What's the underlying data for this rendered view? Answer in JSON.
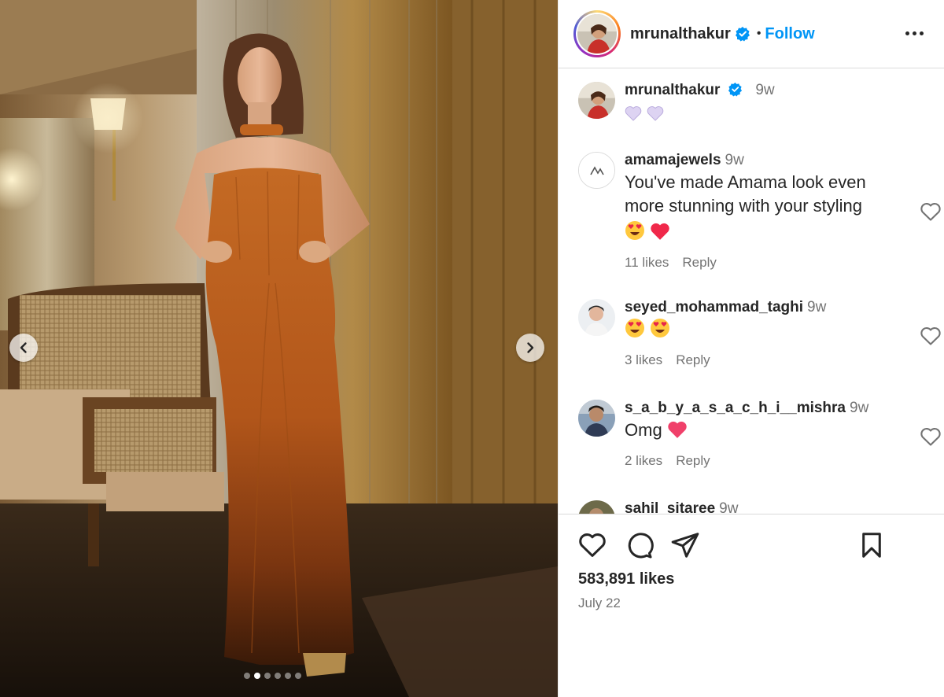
{
  "post": {
    "username": "mrunalthakur",
    "follow_label": "Follow",
    "separator": "•",
    "likes": "583,891 likes",
    "date": "July 22",
    "carousel_slides": 6,
    "carousel_active_index": 1
  },
  "caption": {
    "username": "mrunalthakur",
    "time": "9w",
    "text_emoji": "purple-heart-emoji x2"
  },
  "comments": [
    {
      "username": "amamajewels",
      "time": "9w",
      "text": "You've made Amama look even more stunning with your styling",
      "emoji": "heart-eyes-emoji, red-heart-emoji",
      "likes": "11 likes",
      "reply": "Reply"
    },
    {
      "username": "seyed_mohammad_taghi",
      "time": "9w",
      "text": "",
      "emoji": "heart-eyes-emoji x2",
      "likes": "3 likes",
      "reply": "Reply"
    },
    {
      "username": "s_a_b_y_a_s_a_c_h_i__mishra",
      "time": "9w",
      "text": "Omg",
      "emoji": "pink-heart-emoji",
      "likes": "2 likes",
      "reply": "Reply"
    },
    {
      "username": "sahil_sitaree",
      "time": "9w"
    }
  ],
  "colors": {
    "accent_blue": "#0095f6",
    "text_primary": "#262626",
    "text_secondary": "#737373",
    "divider": "#dbdbdb",
    "dress": "#c0651f"
  },
  "icons": [
    "chevron-left-icon",
    "chevron-right-icon",
    "verified-badge-icon",
    "more-options-icon",
    "heart-icon",
    "comment-icon",
    "share-icon",
    "bookmark-icon"
  ]
}
